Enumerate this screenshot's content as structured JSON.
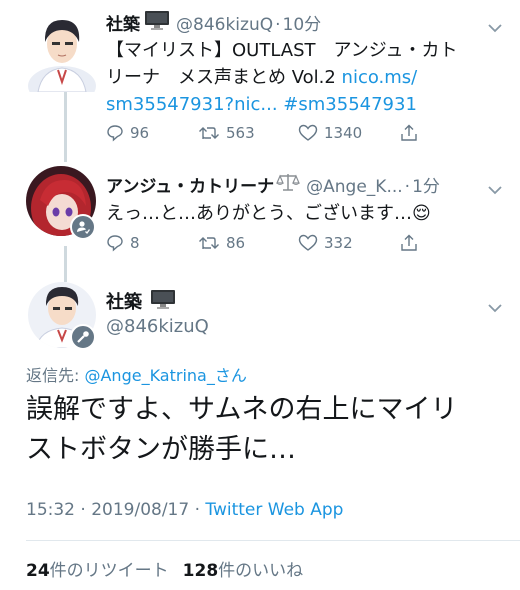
{
  "tweets": [
    {
      "name": "社築",
      "handle": "@846kizuQ",
      "sep": "·",
      "time": "10分",
      "line1": "【マイリスト】OUTLAST　アンジュ・カト",
      "line2": "リーナ　メス声まとめ Vol.2 ",
      "link1": "nico.ms/",
      "link2": "sm35547931?nic...",
      "hashtag": "#sm35547931",
      "replies": "96",
      "retweets": "563",
      "likes": "1340"
    },
    {
      "name": "アンジュ・カトリーナ",
      "handle": "@Ange_K...",
      "sep": "·",
      "time": "1分",
      "text": "えっ…と…ありがとう、ございます…",
      "emoji": "😌",
      "replies": "8",
      "retweets": "86",
      "likes": "332"
    }
  ],
  "focus": {
    "name": "社築",
    "handle": "@846kizuQ",
    "reply_label": "返信先: ",
    "reply_to": "@Ange_Katrina_さん",
    "line1": "誤解ですよ、サムネの右上にマイリ",
    "line2": "ストボタンが勝手に…",
    "time": "15:32 · 2019/08/17 · ",
    "source": "Twitter Web App",
    "retweet_count": "24",
    "retweet_label": "件のリツイート",
    "like_count": "128",
    "like_label": "件のいいね"
  },
  "colors": {
    "link": "#1b95e0",
    "muted": "#657786",
    "text": "#14171a"
  },
  "icons": [
    "monitor-icon",
    "scales-icon",
    "reply-icon",
    "retweet-icon",
    "like-icon",
    "share-icon",
    "chevron-down-icon"
  ]
}
